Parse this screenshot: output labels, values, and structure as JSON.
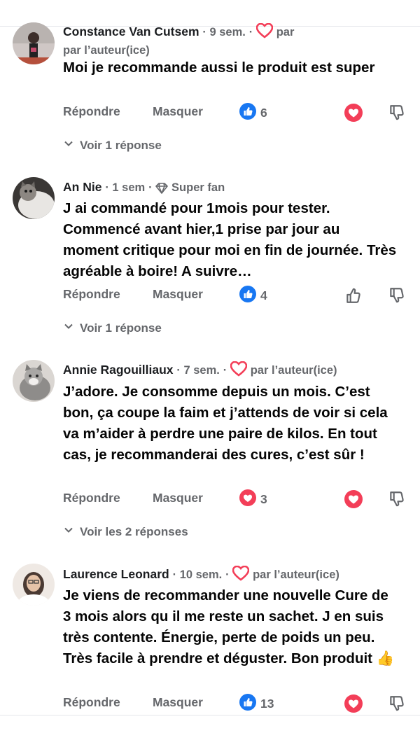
{
  "ui": {
    "reply_label": "Répondre",
    "hide_label": "Masquer",
    "by_author": "par l’auteur(ice)"
  },
  "comments": [
    {
      "name": "Constance Van Cutsem",
      "time": "9 sem.",
      "badge": "",
      "body": "Moi je recommande aussi le produit est super",
      "reaction": "like",
      "count": "6",
      "liked_by_author": true,
      "replies": "Voir 1 réponse"
    },
    {
      "name": "An Nie",
      "time": "1 sem",
      "badge": "Super fan",
      "body": "J ai commandé pour 1mois pour tester. Commencé avant hier,1 prise par jour au moment critique pour moi en fin de journée. Très agréable à boire! A suivre…",
      "reaction": "like",
      "count": "4",
      "liked_by_author": false,
      "replies": "Voir 1 réponse"
    },
    {
      "name": "Annie Ragouilliaux",
      "time": "7 sem.",
      "badge": "",
      "body": "J’adore. Je consomme depuis un mois. C’est bon, ça coupe la faim et j’attends de voir si cela va m’aider à perdre une paire de kilos. En tout cas, je recommanderai des cures, c’est sûr !",
      "reaction": "love",
      "count": "3",
      "liked_by_author": true,
      "replies": "Voir les 2 réponses"
    },
    {
      "name": "Laurence Leonard",
      "time": "10 sem.",
      "badge": "",
      "body": "Je viens de recommander une nouvelle Cure de 3 mois alors qu il me reste un sachet. J en suis très contente. Énergie, perte de poids un peu. Très facile à prendre et déguster. Bon produit 👍",
      "reaction": "like",
      "count": "13",
      "liked_by_author": true,
      "replies": ""
    }
  ],
  "colors": {
    "like_blue": "#1877f2",
    "love_red": "#f33e58",
    "secondary_text": "#65676b"
  },
  "icons": [
    "like-icon",
    "love-icon",
    "heart-outline-icon",
    "dislike-icon",
    "thumbs-up-outline-icon",
    "diamond-icon",
    "chevron-down-icon"
  ]
}
